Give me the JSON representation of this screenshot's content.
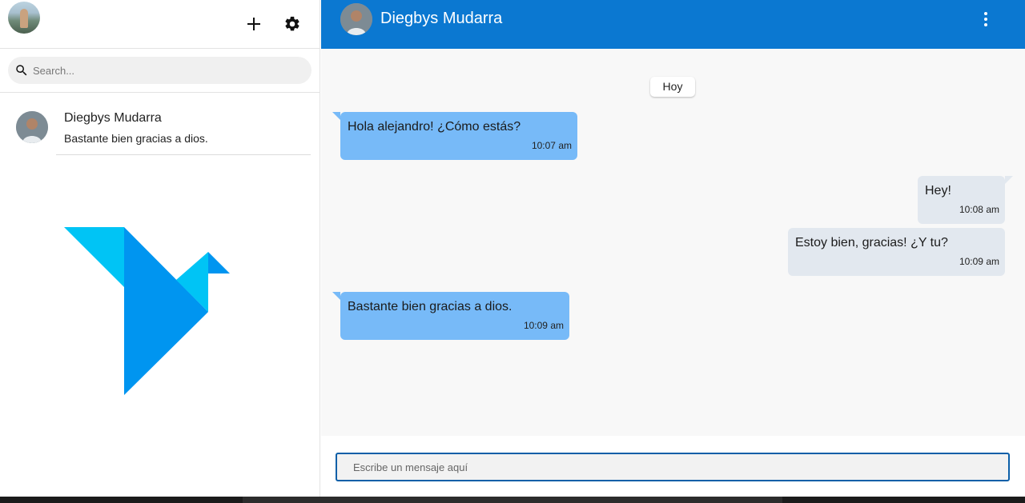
{
  "sidebar": {
    "header": {
      "my_avatar": "user-avatar",
      "add_icon": "plus-icon",
      "settings_icon": "gear-icon"
    },
    "search": {
      "icon": "search-icon",
      "placeholder": "Search..."
    },
    "contacts": [
      {
        "name": "Diegbys Mudarra",
        "last_message": "Bastante bien gracias a dios."
      }
    ],
    "logo": "origami-bird-logo"
  },
  "chat": {
    "header": {
      "title": "Diegbys Mudarra",
      "menu_icon": "more-vertical-icon"
    },
    "day_label": "Hoy",
    "messages": [
      {
        "direction": "in",
        "text": "Hola alejandro! ¿Cómo estás?",
        "time": "10:07 am"
      },
      {
        "direction": "out",
        "text": "Hey!",
        "time": "10:08 am"
      },
      {
        "direction": "out",
        "text": "Estoy bien, gracias! ¿Y tu?",
        "time": "10:09 am"
      },
      {
        "direction": "in",
        "text": "Bastante bien gracias a dios.",
        "time": "10:09 am"
      }
    ],
    "composer": {
      "placeholder": "Escribe un mensaje aquí"
    }
  },
  "colors": {
    "header_blue": "#0b78d1",
    "incoming_bubble": "#77baf8",
    "outgoing_bubble": "#e2e8ef",
    "logo_light": "#00c4f5",
    "logo_dark": "#0095f0"
  }
}
